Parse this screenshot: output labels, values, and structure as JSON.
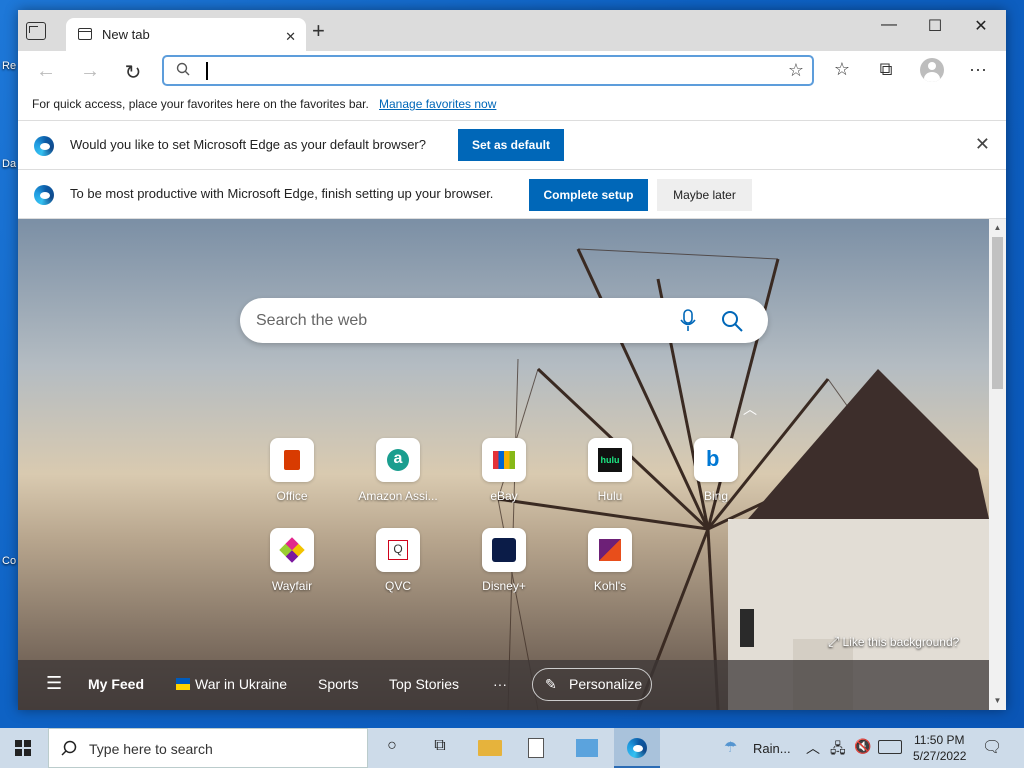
{
  "desktop": {
    "icon_labels": [
      "Re",
      "Da",
      "Co"
    ]
  },
  "tab": {
    "title": "New tab",
    "close": "✕",
    "new": "+"
  },
  "window_controls": {
    "minimize": "—",
    "maximize": "☐",
    "close": "✕"
  },
  "favorites_bar": {
    "text": "For quick access, place your favorites here on the favorites bar.",
    "link": "Manage favorites now"
  },
  "default_bar": {
    "text": "Would you like to set Microsoft Edge as your default browser?",
    "button": "Set as default",
    "close": "✕"
  },
  "setup_bar": {
    "text": "To be most productive with Microsoft Edge, finish setting up your browser.",
    "primary": "Complete setup",
    "secondary": "Maybe later"
  },
  "search": {
    "placeholder": "Search the web"
  },
  "tiles": [
    {
      "label": "Office",
      "icon": "office-icon",
      "color": "#d83b01"
    },
    {
      "label": "Amazon Assi...",
      "icon": "amazon-assistant-icon",
      "color": "#1a9e8f"
    },
    {
      "label": "eBay",
      "icon": "ebay-icon",
      "color": "#e53238"
    },
    {
      "label": "Hulu",
      "icon": "hulu-icon",
      "color": "#1ce783"
    },
    {
      "label": "Bing",
      "icon": "bing-icon",
      "color": "#0078d4"
    },
    {
      "label": "Wayfair",
      "icon": "wayfair-icon",
      "color": "#7b189f"
    },
    {
      "label": "QVC",
      "icon": "qvc-icon",
      "color": "#d0021b"
    },
    {
      "label": "Disney+",
      "icon": "disney-plus-icon",
      "color": "#0b1c48"
    },
    {
      "label": "Kohl's",
      "icon": "kohls-icon",
      "color": "#6d2077"
    }
  ],
  "like_background": "Like this background?",
  "feed": {
    "menu": "☰",
    "my_feed": "My Feed",
    "war": "War in Ukraine",
    "sports": "Sports",
    "top": "Top Stories",
    "more": "···",
    "personalize": "Personalize"
  },
  "taskbar": {
    "search_placeholder": "Type here to search",
    "weather": "Rain...",
    "time": "11:50 PM",
    "date": "5/27/2022"
  }
}
